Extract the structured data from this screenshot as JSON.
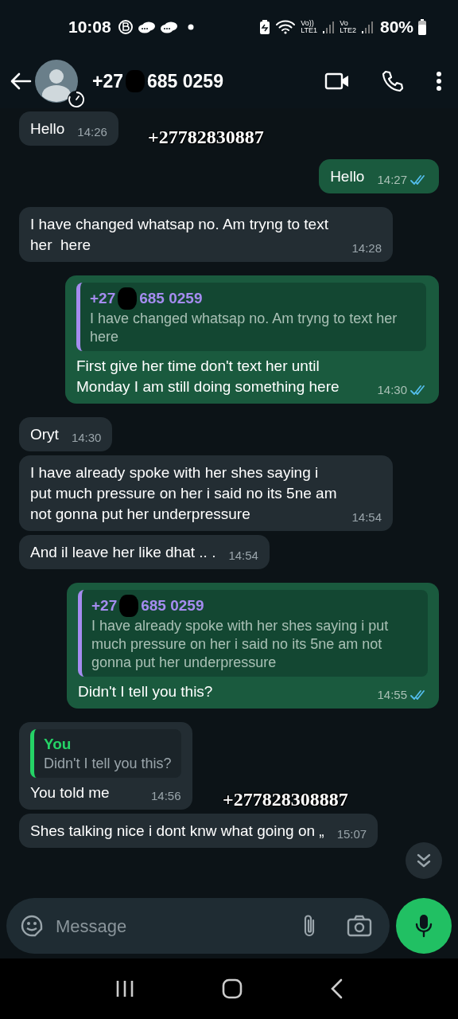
{
  "status_bar": {
    "time": "10:08",
    "sims": [
      {
        "top": "Vo))",
        "bottom": "LTE1"
      },
      {
        "top": "Vo",
        "bottom": "LTE2"
      }
    ],
    "battery": "80%"
  },
  "header": {
    "number_prefix": "+27",
    "number_suffix": "685 0259",
    "redacted": true
  },
  "messages": [
    {
      "kind": "incoming",
      "text": "Hello",
      "time": "14:26"
    },
    {
      "kind": "outgoing",
      "text": "Hello",
      "time": "14:27",
      "read": true
    },
    {
      "kind": "incoming",
      "text": "I have changed whatsap no. Am tryng to text her  here",
      "time": "14:28"
    },
    {
      "kind": "outgoing",
      "quote": {
        "author_prefix": "+27",
        "author_suffix": "685 0259",
        "redacted": true,
        "text": "I have changed whatsap no. Am tryng to text her here"
      },
      "text": "First give her time don't text her until Monday I am still doing something here",
      "time": "14:30",
      "read": true
    },
    {
      "kind": "incoming",
      "text": "Oryt",
      "time": "14:30"
    },
    {
      "kind": "incoming",
      "text": "I have already spoke with her shes saying i put much pressure on her i said no its 5ne am not gonna put her underpressure",
      "time": "14:54"
    },
    {
      "kind": "incoming",
      "text": "And il leave her like dhat .. .",
      "time": "14:54"
    },
    {
      "kind": "outgoing",
      "quote": {
        "author_prefix": "+27",
        "author_suffix": "685 0259",
        "redacted": true,
        "text": "I have already spoke with her shes saying i put much pressure on her i said no its 5ne am not gonna put her underpressure"
      },
      "text": "Didn't I tell you this?",
      "time": "14:55",
      "read": true
    },
    {
      "kind": "incoming",
      "quote": {
        "author_prefix": "You",
        "redacted": false,
        "text": "Didn't I tell you this?"
      },
      "text": "You told me",
      "time": "14:56"
    },
    {
      "kind": "incoming",
      "text": "Shes talking nice i dont knw what going on „",
      "time": "15:07"
    }
  ],
  "overlay_notes": [
    {
      "text": "+27782830887"
    },
    {
      "text": "+277828308887"
    }
  ],
  "composer": {
    "placeholder": "Message"
  }
}
